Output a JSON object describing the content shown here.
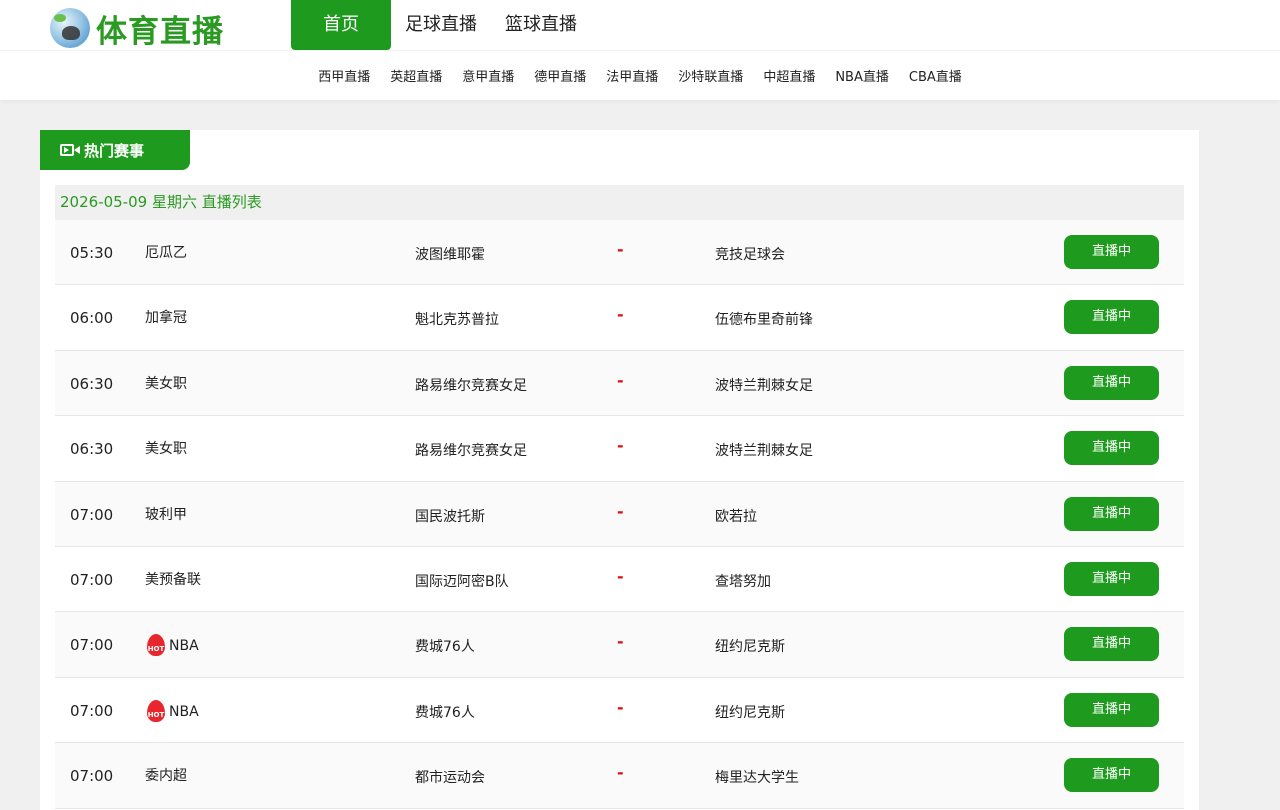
{
  "logo": {
    "text": "体育直播",
    "icon": "soccer-ball-logo-icon"
  },
  "nav": {
    "items": [
      {
        "label": "首页",
        "active": true
      },
      {
        "label": "足球直播",
        "active": false
      },
      {
        "label": "篮球直播",
        "active": false
      }
    ]
  },
  "subnav": {
    "items": [
      "西甲直播",
      "英超直播",
      "意甲直播",
      "德甲直播",
      "法甲直播",
      "沙特联直播",
      "中超直播",
      "NBA直播",
      "CBA直播"
    ]
  },
  "panel": {
    "title": "热门赛事",
    "title_icon": "video-camera-icon",
    "date_heading": "2026-05-09 星期六 直播列表"
  },
  "colors": {
    "brand_green": "#1e9b1e",
    "vs_red": "#e01010",
    "hot_red": "#e8262d"
  },
  "matches": [
    {
      "time": "05:30",
      "league": "厄瓜乙",
      "hot": false,
      "home": "波图维耶霍",
      "vs": "-",
      "away": "竞技足球会",
      "status": "直播中"
    },
    {
      "time": "06:00",
      "league": "加拿冠",
      "hot": false,
      "home": "魁北克苏普拉",
      "vs": "-",
      "away": "伍德布里奇前锋",
      "status": "直播中"
    },
    {
      "time": "06:30",
      "league": "美女职",
      "hot": false,
      "home": "路易维尔竞赛女足",
      "vs": "-",
      "away": "波特兰荆棘女足",
      "status": "直播中"
    },
    {
      "time": "06:30",
      "league": "美女职",
      "hot": false,
      "home": "路易维尔竞赛女足",
      "vs": "-",
      "away": "波特兰荆棘女足",
      "status": "直播中"
    },
    {
      "time": "07:00",
      "league": "玻利甲",
      "hot": false,
      "home": "国民波托斯",
      "vs": "-",
      "away": "欧若拉",
      "status": "直播中"
    },
    {
      "time": "07:00",
      "league": "美预备联",
      "hot": false,
      "home": "国际迈阿密B队",
      "vs": "-",
      "away": "查塔努加",
      "status": "直播中"
    },
    {
      "time": "07:00",
      "league": "NBA",
      "hot": true,
      "home": "费城76人",
      "vs": "-",
      "away": "纽约尼克斯",
      "status": "直播中"
    },
    {
      "time": "07:00",
      "league": "NBA",
      "hot": true,
      "home": "费城76人",
      "vs": "-",
      "away": "纽约尼克斯",
      "status": "直播中"
    },
    {
      "time": "07:00",
      "league": "委内超",
      "hot": false,
      "home": "都市运动会",
      "vs": "-",
      "away": "梅里达大学生",
      "status": "直播中"
    }
  ]
}
